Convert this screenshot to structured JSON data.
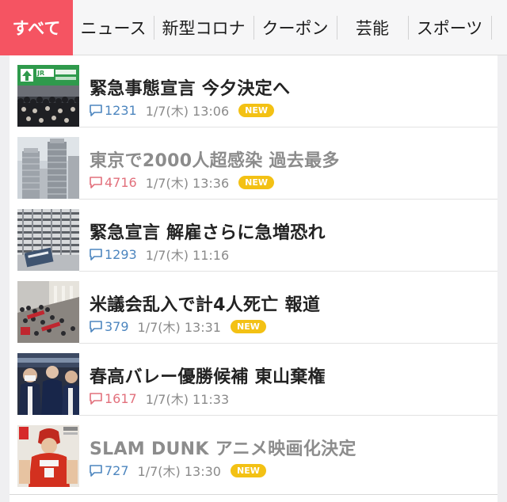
{
  "tabs": [
    {
      "label": "すべて",
      "active": true
    },
    {
      "label": "ニュース"
    },
    {
      "label": "新型コロナ"
    },
    {
      "label": "クーポン"
    },
    {
      "label": "芸能"
    },
    {
      "label": "スポーツ"
    }
  ],
  "articles": [
    {
      "title": "緊急事態宣言 今夕決定へ",
      "comments": "1231",
      "date": "1/7(木) 13:06",
      "badge": "NEW",
      "read": false,
      "hot": false,
      "thumb": "station-crowd"
    },
    {
      "title": "東京で2000人超感染 過去最多",
      "comments": "4716",
      "date": "1/7(木) 13:36",
      "badge": "NEW",
      "read": true,
      "hot": true,
      "thumb": "city-hall-tower"
    },
    {
      "title": "緊急宣言 解雇さらに急増恐れ",
      "comments": "1293",
      "date": "1/7(木) 11:16",
      "badge": "",
      "read": false,
      "hot": false,
      "thumb": "office-building"
    },
    {
      "title": "米議会乱入で計4人死亡 報道",
      "comments": "379",
      "date": "1/7(木) 13:31",
      "badge": "NEW",
      "read": false,
      "hot": false,
      "thumb": "capitol-crowd"
    },
    {
      "title": "春高バレー優勝候補 東山棄権",
      "comments": "1617",
      "date": "1/7(木) 11:33",
      "badge": "",
      "read": false,
      "hot": true,
      "thumb": "volleyball-team"
    },
    {
      "title": "SLAM DUNK アニメ映画化決定",
      "comments": "727",
      "date": "1/7(木) 13:30",
      "badge": "NEW",
      "read": true,
      "hot": false,
      "thumb": "manga-cover"
    }
  ],
  "icons": {
    "comment": "comment-bubble-icon"
  },
  "colors": {
    "accent": "#f55462",
    "comment_count": "#4d86bf",
    "comment_count_hot": "#e2707c",
    "badge": "#f3c114"
  }
}
